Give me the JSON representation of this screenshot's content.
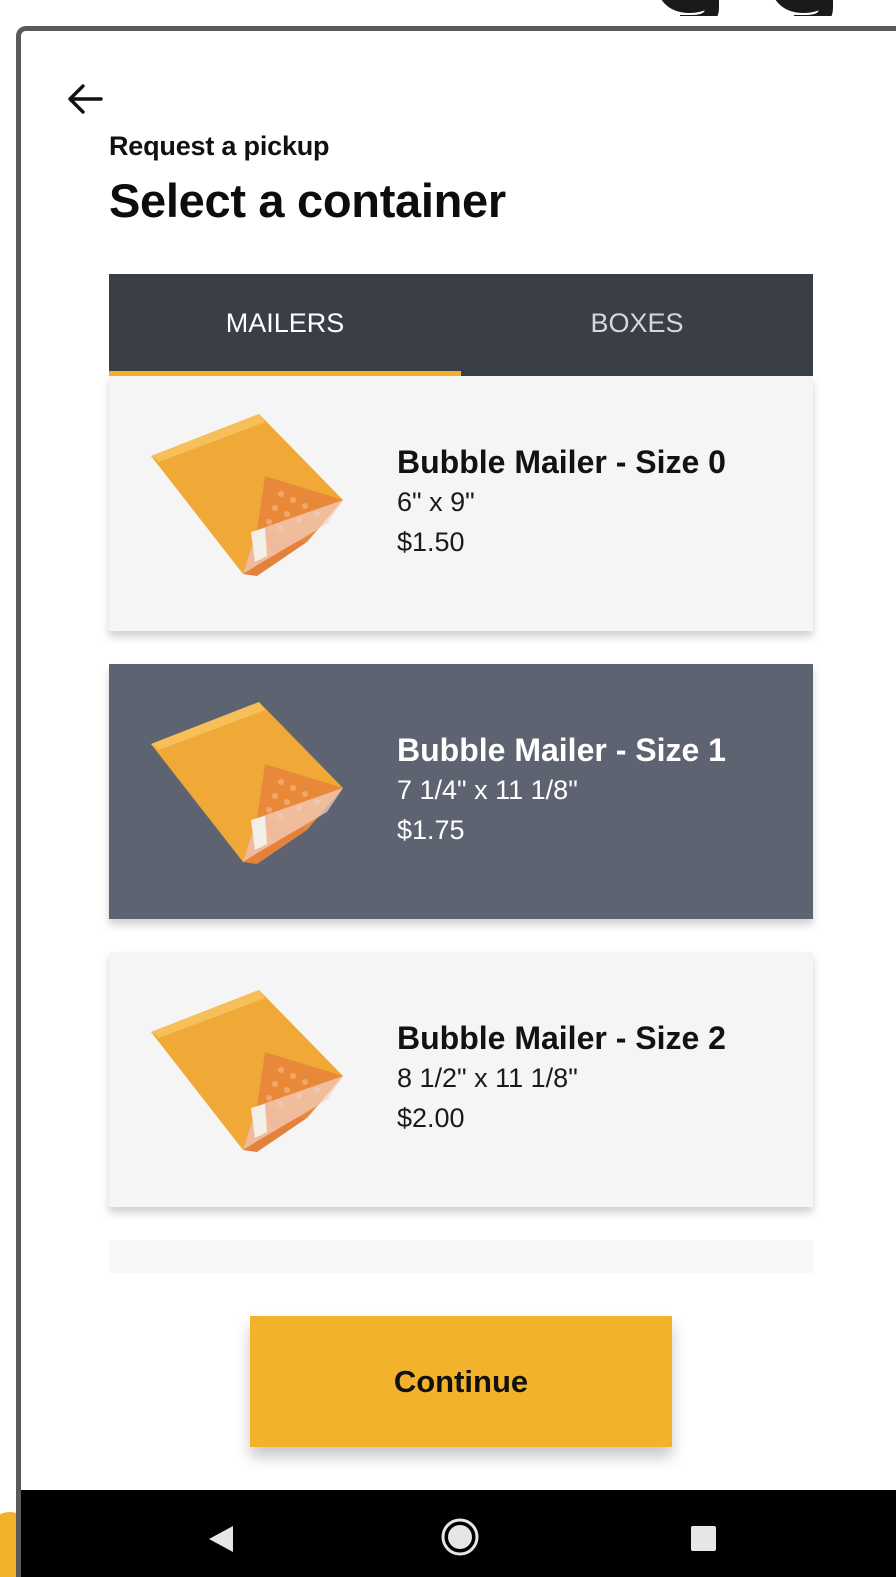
{
  "header": {
    "subtitle": "Request a pickup",
    "title": "Select a container"
  },
  "tabs": [
    {
      "label": "MAILERS",
      "active": true
    },
    {
      "label": "BOXES",
      "active": false
    }
  ],
  "items": [
    {
      "name": "Bubble Mailer - Size 0",
      "dims": "6\" x 9\"",
      "price": "$1.50",
      "selected": false
    },
    {
      "name": "Bubble Mailer - Size 1",
      "dims": "7 1/4\" x 11 1/8\"",
      "price": "$1.75",
      "selected": true
    },
    {
      "name": "Bubble Mailer - Size 2",
      "dims": "8 1/2\" x 11 1/8\"",
      "price": "$2.00",
      "selected": false
    }
  ],
  "continue_label": "Continue",
  "icons": {
    "back": "arrow-left-icon",
    "nav_back": "triangle-left-icon",
    "nav_home": "circle-home-icon",
    "nav_recents": "square-recents-icon"
  },
  "colors": {
    "accent": "#f3b22b",
    "tab_bar": "#3a3e47",
    "selected_card": "#5d6370",
    "card": "#f5f5f5"
  }
}
